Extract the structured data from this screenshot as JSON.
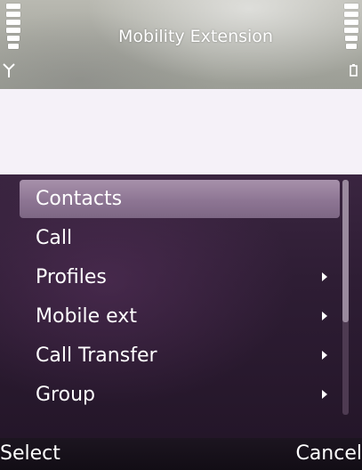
{
  "status_bar": {
    "title": "Mobility Extension",
    "signal_icon": "antenna-icon",
    "battery_icon": "battery-icon"
  },
  "menu": {
    "items": [
      {
        "label": "Contacts",
        "selected": true,
        "has_submenu": false
      },
      {
        "label": "Call",
        "selected": false,
        "has_submenu": false
      },
      {
        "label": "Profiles",
        "selected": false,
        "has_submenu": true
      },
      {
        "label": "Mobile ext",
        "selected": false,
        "has_submenu": true
      },
      {
        "label": "Call Transfer",
        "selected": false,
        "has_submenu": true
      },
      {
        "label": "Group",
        "selected": false,
        "has_submenu": true
      }
    ],
    "scroll_position": 0.0
  },
  "softkeys": {
    "left": "Select",
    "right": "Cancel"
  },
  "colors": {
    "menu_background": "#2e1d34",
    "selection_highlight": "#8d7593",
    "blank_band": "#f5f1f8"
  }
}
